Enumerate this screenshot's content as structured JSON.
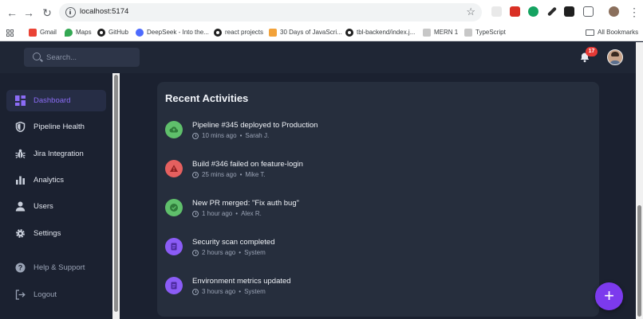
{
  "browser": {
    "url": "localhost:5174",
    "bookmarks": [
      {
        "label": "Gmail",
        "icon": "gmail-icon",
        "color": "#ea4335"
      },
      {
        "label": "Maps",
        "icon": "maps-icon",
        "color": "#34a853"
      },
      {
        "label": "GitHub",
        "icon": "github-icon",
        "color": "#1f1f1f"
      },
      {
        "label": "DeepSeek - Into the...",
        "icon": "deepseek-icon",
        "color": "#4d6bfe"
      },
      {
        "label": "react projects",
        "icon": "github-icon",
        "color": "#1f1f1f"
      },
      {
        "label": "30 Days of JavaScri...",
        "icon": "thirty-days-icon",
        "color": "#f2a23a"
      },
      {
        "label": "tbl-backend/index.j...",
        "icon": "github-icon",
        "color": "#1f1f1f"
      },
      {
        "label": "MERN 1",
        "icon": "p-icon",
        "color": "#c7c7c7"
      },
      {
        "label": "TypeScript",
        "icon": "p-icon",
        "color": "#c7c7c7"
      }
    ],
    "all_bookmarks": "All Bookmarks"
  },
  "header": {
    "search_placeholder": "Search...",
    "notification_count": "17"
  },
  "sidebar": {
    "items": [
      {
        "label": "Dashboard",
        "icon": "dashboard-icon"
      },
      {
        "label": "Pipeline Health",
        "icon": "shield-icon"
      },
      {
        "label": "Jira Integration",
        "icon": "bug-icon"
      },
      {
        "label": "Analytics",
        "icon": "bar-chart-icon"
      },
      {
        "label": "Users",
        "icon": "user-icon"
      },
      {
        "label": "Settings",
        "icon": "gear-icon"
      }
    ],
    "help": "Help & Support",
    "logout": "Logout"
  },
  "main": {
    "title": "Recent Activities",
    "activities": [
      {
        "title": "Pipeline #345 deployed to Production",
        "time": "10 mins ago",
        "user": "Sarah J.",
        "icon": "cloud-upload-icon",
        "color": "#5fbf6b"
      },
      {
        "title": "Build #346 failed on feature-login",
        "time": "25 mins ago",
        "user": "Mike T.",
        "icon": "warning-icon",
        "color": "#e5605f"
      },
      {
        "title": "New PR merged: \"Fix auth bug\"",
        "time": "1 hour ago",
        "user": "Alex R.",
        "icon": "check-icon",
        "color": "#5fbf6b"
      },
      {
        "title": "Security scan completed",
        "time": "2 hours ago",
        "user": "System",
        "icon": "clipboard-icon",
        "color": "#8b5cf6"
      },
      {
        "title": "Environment metrics updated",
        "time": "3 hours ago",
        "user": "System",
        "icon": "clipboard-icon",
        "color": "#8b5cf6"
      }
    ],
    "fab_label": "+"
  },
  "colors": {
    "accent": "#7c3aed",
    "sidebar_active_text": "#8b6cf6",
    "notification_badge": "#e53935"
  }
}
